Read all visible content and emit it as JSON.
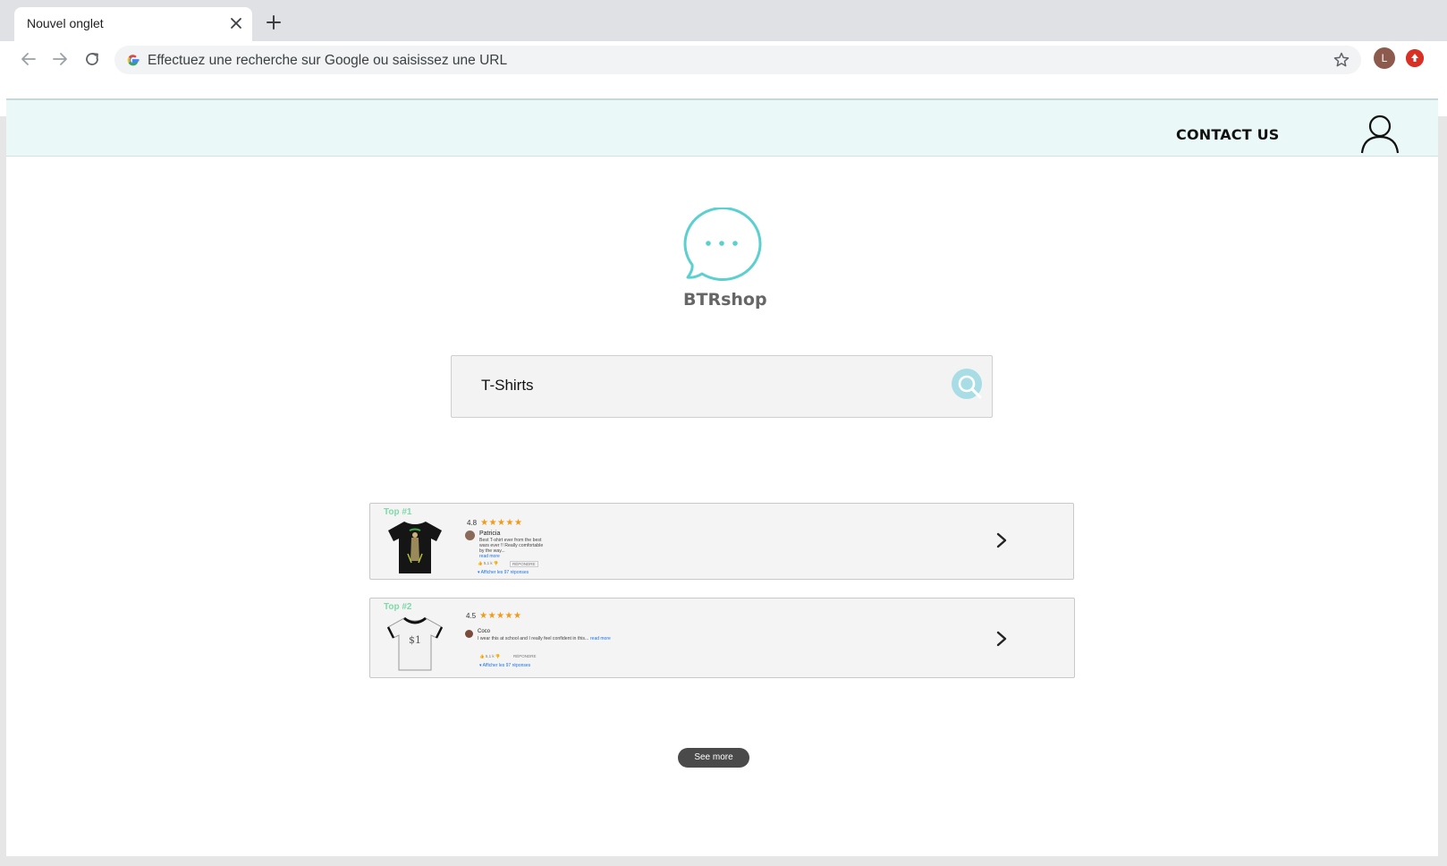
{
  "browser": {
    "tab_title": "Nouvel onglet",
    "omnibox_placeholder": "Effectuez une recherche sur Google ou saisissez une URL",
    "profile_initial": "L"
  },
  "header": {
    "contact_label": "CONTACT US"
  },
  "brand": {
    "name": "BTRshop",
    "accent_color": "#5ccfcf"
  },
  "search": {
    "value": "T-Shirts"
  },
  "results": [
    {
      "rank": "Top #1",
      "rating": "4.8",
      "stars": "★★★★★",
      "reviewer": "Patricia",
      "review": "Best T-shirt ever from the best wars ever !! Really comfortable by the way...",
      "read_more": "read more",
      "likes": "5,1 k",
      "reply": "RÉPONDRE",
      "replies": "Afficher les 97 réponses"
    },
    {
      "rank": "Top #2",
      "rating": "4.5",
      "stars": "★★★★★",
      "reviewer": "Coco",
      "review": "I wear this at school and I really feel confident in this...",
      "read_more": "read more",
      "likes": "5,1 k",
      "reply": "RÉPONDRE",
      "replies": "Afficher les 97 réponses"
    }
  ],
  "see_more_label": "See more"
}
